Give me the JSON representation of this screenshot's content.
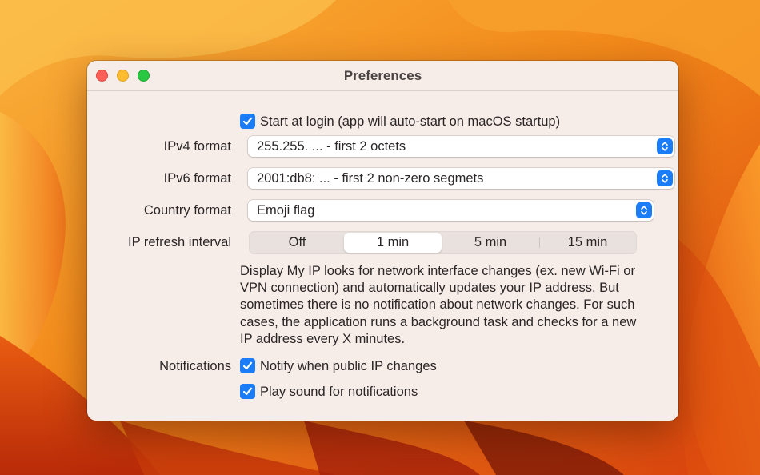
{
  "window": {
    "title": "Preferences"
  },
  "start_at_login": {
    "checked": true,
    "label": "Start at login (app will auto-start on macOS startup)"
  },
  "ipv4": {
    "label": "IPv4 format",
    "value": "255.255. ... - first 2 octets"
  },
  "ipv6": {
    "label": "IPv6 format",
    "value": "2001:db8: ... - first 2 non-zero segmets"
  },
  "country": {
    "label": "Country format",
    "value": "Emoji flag"
  },
  "refresh": {
    "label": "IP refresh interval",
    "options": [
      "Off",
      "1 min",
      "5 min",
      "15 min"
    ],
    "selected": "1 min"
  },
  "description": "Display My IP looks for network interface changes (ex. new Wi-Fi or VPN connection) and automatically updates your IP address. But sometimes there is no notification about network changes. For such cases, the application runs a background task and checks for a new IP address every X minutes.",
  "notifications": {
    "label": "Notifications",
    "notify": {
      "checked": true,
      "label": "Notify when public IP changes"
    },
    "sound": {
      "checked": true,
      "label": "Play sound for notifications"
    }
  },
  "colors": {
    "accent": "#1a7cf6",
    "window_bg": "#f6ece8"
  },
  "icons": {
    "checkbox": "checkmark-icon",
    "popup": "chevron-up-down-icon"
  }
}
